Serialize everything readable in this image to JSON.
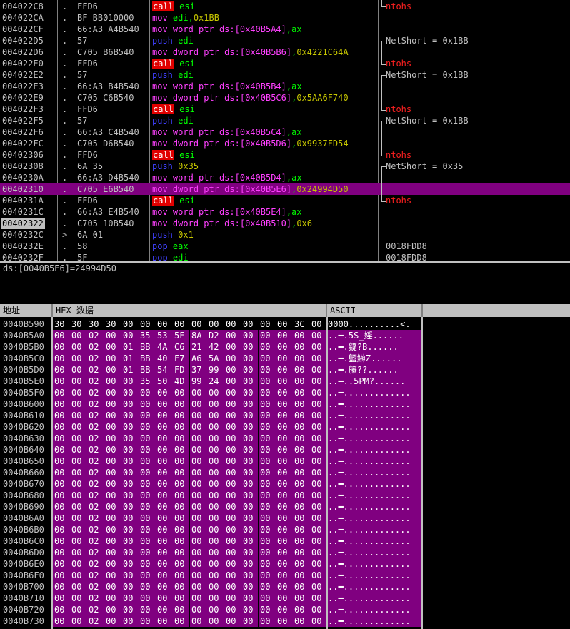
{
  "disasm": {
    "rows": [
      {
        "addr": "004022C8",
        "mark": ".",
        "hex": "FFD6",
        "mn": "call",
        "mnc": "call",
        "ops": [
          [
            "esi",
            "g"
          ]
        ],
        "cmt": "ntohs",
        "cmtc": "red",
        "bracket": "end"
      },
      {
        "addr": "004022CA",
        "mark": ".",
        "hex": "BF BB010000",
        "mn": "mov",
        "mnc": "mov",
        "ops": [
          [
            "edi,",
            "g"
          ],
          [
            "0x1BB",
            "y"
          ]
        ],
        "cmt": "",
        "cmtc": "w"
      },
      {
        "addr": "004022CF",
        "mark": ".",
        "hex": "66:A3 A4B540",
        "mn": "mov",
        "mnc": "mov",
        "ops": [
          [
            "word ptr ds:[0x40B5A4]",
            "m"
          ],
          [
            ",ax",
            "g"
          ]
        ],
        "cmt": "",
        "cmtc": "w"
      },
      {
        "addr": "004022D5",
        "mark": ".",
        "hex": "57",
        "mn": "push",
        "mnc": "push",
        "ops": [
          [
            "edi",
            "g"
          ]
        ],
        "cmt": "NetShort = 0x1BB",
        "cmtc": "w",
        "bracket": "start"
      },
      {
        "addr": "004022D6",
        "mark": ".",
        "hex": "C705 B6B540",
        "mn": "mov",
        "mnc": "mov",
        "ops": [
          [
            "dword ptr ds:[0x40B5B6]",
            "m"
          ],
          [
            ",",
            "g"
          ],
          [
            "0x4221C64A",
            "y"
          ]
        ],
        "cmt": "",
        "cmtc": "w"
      },
      {
        "addr": "004022E0",
        "mark": ".",
        "hex": "FFD6",
        "mn": "call",
        "mnc": "call",
        "ops": [
          [
            "esi",
            "g"
          ]
        ],
        "cmt": "ntohs",
        "cmtc": "red",
        "bracket": "end"
      },
      {
        "addr": "004022E2",
        "mark": ".",
        "hex": "57",
        "mn": "push",
        "mnc": "push",
        "ops": [
          [
            "edi",
            "g"
          ]
        ],
        "cmt": "NetShort = 0x1BB",
        "cmtc": "w",
        "bracket": "start"
      },
      {
        "addr": "004022E3",
        "mark": ".",
        "hex": "66:A3 B4B540",
        "mn": "mov",
        "mnc": "mov",
        "ops": [
          [
            "word ptr ds:[0x40B5B4]",
            "m"
          ],
          [
            ",ax",
            "g"
          ]
        ],
        "cmt": "",
        "cmtc": "w"
      },
      {
        "addr": "004022E9",
        "mark": ".",
        "hex": "C705 C6B540",
        "mn": "mov",
        "mnc": "mov",
        "ops": [
          [
            "dword ptr ds:[0x40B5C6]",
            "m"
          ],
          [
            ",",
            "g"
          ],
          [
            "0x5AA6F740",
            "y"
          ]
        ],
        "cmt": "",
        "cmtc": "w"
      },
      {
        "addr": "004022F3",
        "mark": ".",
        "hex": "FFD6",
        "mn": "call",
        "mnc": "call",
        "ops": [
          [
            "esi",
            "g"
          ]
        ],
        "cmt": "ntohs",
        "cmtc": "red",
        "bracket": "end"
      },
      {
        "addr": "004022F5",
        "mark": ".",
        "hex": "57",
        "mn": "push",
        "mnc": "push",
        "ops": [
          [
            "edi",
            "g"
          ]
        ],
        "cmt": "NetShort = 0x1BB",
        "cmtc": "w",
        "bracket": "start"
      },
      {
        "addr": "004022F6",
        "mark": ".",
        "hex": "66:A3 C4B540",
        "mn": "mov",
        "mnc": "mov",
        "ops": [
          [
            "word ptr ds:[0x40B5C4]",
            "m"
          ],
          [
            ",ax",
            "g"
          ]
        ],
        "cmt": "",
        "cmtc": "w"
      },
      {
        "addr": "004022FC",
        "mark": ".",
        "hex": "C705 D6B540",
        "mn": "mov",
        "mnc": "mov",
        "ops": [
          [
            "dword ptr ds:[0x40B5D6]",
            "m"
          ],
          [
            ",",
            "g"
          ],
          [
            "0x9937FD54",
            "y"
          ]
        ],
        "cmt": "",
        "cmtc": "w"
      },
      {
        "addr": "00402306",
        "mark": ".",
        "hex": "FFD6",
        "mn": "call",
        "mnc": "call",
        "ops": [
          [
            "esi",
            "g"
          ]
        ],
        "cmt": "ntohs",
        "cmtc": "red",
        "bracket": "end"
      },
      {
        "addr": "00402308",
        "mark": ".",
        "hex": "6A 35",
        "mn": "push",
        "mnc": "push",
        "ops": [
          [
            "0x35",
            "y"
          ]
        ],
        "cmt": "NetShort = 0x35",
        "cmtc": "w",
        "bracket": "start"
      },
      {
        "addr": "0040230A",
        "mark": ".",
        "hex": "66:A3 D4B540",
        "mn": "mov",
        "mnc": "mov",
        "ops": [
          [
            "word ptr ds:[0x40B5D4]",
            "m"
          ],
          [
            ",ax",
            "g"
          ]
        ],
        "cmt": "",
        "cmtc": "w"
      },
      {
        "addr": "00402310",
        "mark": ".",
        "hex": "C705 E6B540",
        "mn": "mov",
        "mnc": "mov",
        "ops": [
          [
            "dword ptr ds:[0x40B5E6]",
            "m"
          ],
          [
            ",",
            "g"
          ],
          [
            "0x24994D50",
            "y"
          ]
        ],
        "cmt": "",
        "cmtc": "w",
        "selected": true
      },
      {
        "addr": "0040231A",
        "mark": ".",
        "hex": "FFD6",
        "mn": "call",
        "mnc": "call",
        "ops": [
          [
            "esi",
            "g"
          ]
        ],
        "cmt": "ntohs",
        "cmtc": "red",
        "bracket": "end"
      },
      {
        "addr": "0040231C",
        "mark": ".",
        "hex": "66:A3 E4B540",
        "mn": "mov",
        "mnc": "mov",
        "ops": [
          [
            "word ptr ds:[0x40B5E4]",
            "m"
          ],
          [
            ",ax",
            "g"
          ]
        ],
        "cmt": "",
        "cmtc": "w"
      },
      {
        "addr": "00402322",
        "mark": ".",
        "hex": "C705 10B540",
        "mn": "mov",
        "mnc": "mov",
        "ops": [
          [
            "dword ptr ds:[0x40B510]",
            "m"
          ],
          [
            ",",
            "g"
          ],
          [
            "0x6",
            "y"
          ]
        ],
        "cmt": "",
        "cmtc": "w",
        "current": true
      },
      {
        "addr": "0040232C",
        "mark": ">",
        "hex": "6A 01",
        "mn": "push",
        "mnc": "push",
        "ops": [
          [
            "0x1",
            "y"
          ]
        ],
        "cmt": "",
        "cmtc": "w"
      },
      {
        "addr": "0040232E",
        "mark": ".",
        "hex": "58",
        "mn": "pop",
        "mnc": "pop",
        "ops": [
          [
            "eax",
            "g"
          ]
        ],
        "cmt": "0018FDD8",
        "cmtc": "w"
      },
      {
        "addr": "0040232F",
        "mark": ".",
        "hex": "5F",
        "mn": "pop",
        "mnc": "pop",
        "ops": [
          [
            "edi",
            "g"
          ]
        ],
        "cmt": "0018FDD8",
        "cmtc": "w"
      }
    ]
  },
  "info": {
    "text": "ds:[0040B5E6]=24994D50"
  },
  "dump": {
    "header_addr": "地址",
    "header_hex": "HEX 数据",
    "header_ascii": "ASCII",
    "rows": [
      {
        "addr": "0040B590",
        "bytes": "30 30 30 30 00 00 00 00 00 00 00 00 00 00 3C 00",
        "ascii": "0000..........<.",
        "pur": false
      },
      {
        "addr": "0040B5A0",
        "bytes": "00 00 02 00 00 35 53 5F 8A D2 00 00 00 00 00 00",
        "ascii": "..━.5S_婬......",
        "pur": true
      },
      {
        "addr": "0040B5B0",
        "bytes": "00 00 02 00 01 BB 4A C6 21 42 00 00 00 00 00 00",
        "ascii": "..━.籎?B......",
        "pur": true
      },
      {
        "addr": "0040B5C0",
        "bytes": "00 00 02 00 01 BB 40 F7 A6 5A 00 00 00 00 00 00",
        "ascii": "..━.籃鰰Z......",
        "pur": true
      },
      {
        "addr": "0040B5D0",
        "bytes": "00 00 02 00 01 BB 54 FD 37 99 00 00 00 00 00 00",
        "ascii": "..━.籘??......",
        "pur": true
      },
      {
        "addr": "0040B5E0",
        "bytes": "00 00 02 00 00 35 50 4D 99 24 00 00 00 00 00 00",
        "ascii": "..━..5PM?......",
        "pur": true
      },
      {
        "addr": "0040B5F0",
        "bytes": "00 00 02 00 00 00 00 00 00 00 00 00 00 00 00 00",
        "ascii": "..━.............",
        "pur": true
      },
      {
        "addr": "0040B600",
        "bytes": "00 00 02 00 00 00 00 00 00 00 00 00 00 00 00 00",
        "ascii": "..━.............",
        "pur": true
      },
      {
        "addr": "0040B610",
        "bytes": "00 00 02 00 00 00 00 00 00 00 00 00 00 00 00 00",
        "ascii": "..━.............",
        "pur": true
      },
      {
        "addr": "0040B620",
        "bytes": "00 00 02 00 00 00 00 00 00 00 00 00 00 00 00 00",
        "ascii": "..━.............",
        "pur": true
      },
      {
        "addr": "0040B630",
        "bytes": "00 00 02 00 00 00 00 00 00 00 00 00 00 00 00 00",
        "ascii": "..━.............",
        "pur": true
      },
      {
        "addr": "0040B640",
        "bytes": "00 00 02 00 00 00 00 00 00 00 00 00 00 00 00 00",
        "ascii": "..━.............",
        "pur": true
      },
      {
        "addr": "0040B650",
        "bytes": "00 00 02 00 00 00 00 00 00 00 00 00 00 00 00 00",
        "ascii": "..━.............",
        "pur": true
      },
      {
        "addr": "0040B660",
        "bytes": "00 00 02 00 00 00 00 00 00 00 00 00 00 00 00 00",
        "ascii": "..━.............",
        "pur": true
      },
      {
        "addr": "0040B670",
        "bytes": "00 00 02 00 00 00 00 00 00 00 00 00 00 00 00 00",
        "ascii": "..━.............",
        "pur": true
      },
      {
        "addr": "0040B680",
        "bytes": "00 00 02 00 00 00 00 00 00 00 00 00 00 00 00 00",
        "ascii": "..━.............",
        "pur": true
      },
      {
        "addr": "0040B690",
        "bytes": "00 00 02 00 00 00 00 00 00 00 00 00 00 00 00 00",
        "ascii": "..━.............",
        "pur": true
      },
      {
        "addr": "0040B6A0",
        "bytes": "00 00 02 00 00 00 00 00 00 00 00 00 00 00 00 00",
        "ascii": "..━.............",
        "pur": true
      },
      {
        "addr": "0040B6B0",
        "bytes": "00 00 02 00 00 00 00 00 00 00 00 00 00 00 00 00",
        "ascii": "..━.............",
        "pur": true
      },
      {
        "addr": "0040B6C0",
        "bytes": "00 00 02 00 00 00 00 00 00 00 00 00 00 00 00 00",
        "ascii": "..━.............",
        "pur": true
      },
      {
        "addr": "0040B6D0",
        "bytes": "00 00 02 00 00 00 00 00 00 00 00 00 00 00 00 00",
        "ascii": "..━.............",
        "pur": true
      },
      {
        "addr": "0040B6E0",
        "bytes": "00 00 02 00 00 00 00 00 00 00 00 00 00 00 00 00",
        "ascii": "..━.............",
        "pur": true
      },
      {
        "addr": "0040B6F0",
        "bytes": "00 00 02 00 00 00 00 00 00 00 00 00 00 00 00 00",
        "ascii": "..━.............",
        "pur": true
      },
      {
        "addr": "0040B700",
        "bytes": "00 00 02 00 00 00 00 00 00 00 00 00 00 00 00 00",
        "ascii": "..━.............",
        "pur": true
      },
      {
        "addr": "0040B710",
        "bytes": "00 00 02 00 00 00 00 00 00 00 00 00 00 00 00 00",
        "ascii": "..━.............",
        "pur": true
      },
      {
        "addr": "0040B720",
        "bytes": "00 00 02 00 00 00 00 00 00 00 00 00 00 00 00 00",
        "ascii": "..━.............",
        "pur": true
      },
      {
        "addr": "0040B730",
        "bytes": "00 00 02 00 00 00 00 00 00 00 00 00 00 00 00 00",
        "ascii": "..━.............",
        "pur": true
      }
    ]
  },
  "colors": {
    "selected_row": "#800080",
    "call_bg": "#e00000",
    "register": "#00ff00",
    "memory": "#ff40ff",
    "immediate": "#c8c800",
    "push_pop": "#4040ff",
    "comment_red": "#ff2020"
  }
}
